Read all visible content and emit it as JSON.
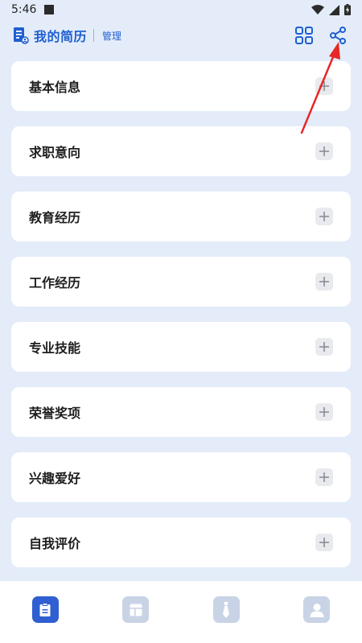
{
  "status_bar": {
    "time": "5:46",
    "icons": [
      "stop-square-icon",
      "wifi-icon",
      "signal-icon",
      "battery-charging-icon"
    ]
  },
  "header": {
    "title": "我的简历",
    "manage_label": "管理",
    "icons": [
      "resume-doc-icon",
      "grid-icon",
      "share-icon"
    ]
  },
  "sections": [
    {
      "title": "基本信息"
    },
    {
      "title": "求职意向"
    },
    {
      "title": "教育经历"
    },
    {
      "title": "工作经历"
    },
    {
      "title": "专业技能"
    },
    {
      "title": "荣誉奖项"
    },
    {
      "title": "兴趣爱好"
    },
    {
      "title": "自我评价"
    }
  ],
  "bottom_nav": {
    "items": [
      {
        "icon": "resume-icon",
        "active": true
      },
      {
        "icon": "template-icon",
        "active": false
      },
      {
        "icon": "tie-icon",
        "active": false
      },
      {
        "icon": "user-icon",
        "active": false
      }
    ]
  },
  "colors": {
    "background": "#e3ecf8",
    "accent": "#1f5fd0",
    "nav_active": "#2f5fd0",
    "nav_inactive": "#c9d3e6",
    "arrow": "#e62727"
  }
}
